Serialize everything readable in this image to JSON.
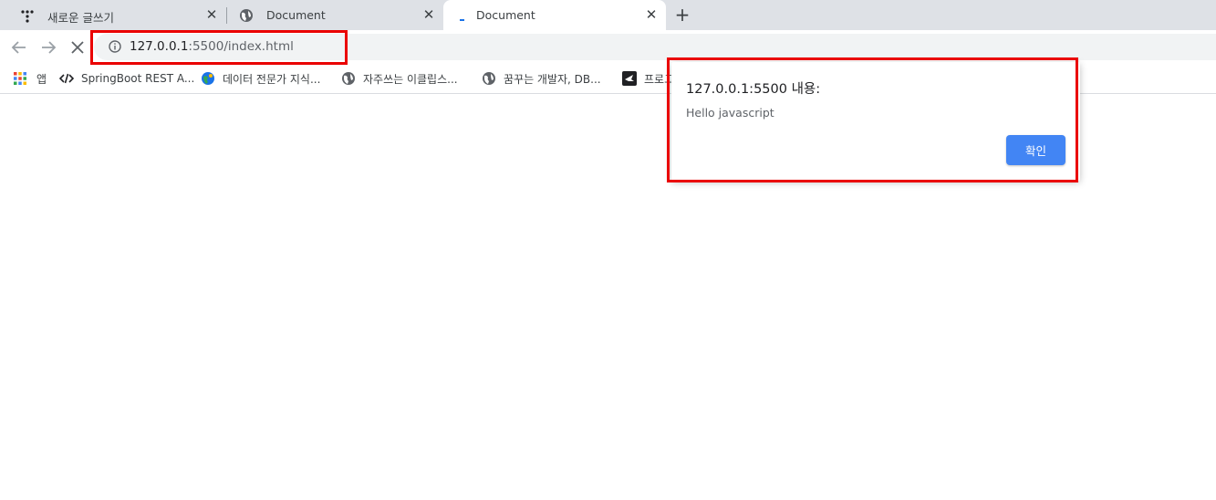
{
  "tabs": [
    {
      "title": "새로운 글쓰기",
      "icon": "tistory-icon",
      "active": false
    },
    {
      "title": "Document",
      "icon": "globe-icon",
      "active": false
    },
    {
      "title": "Document",
      "icon": "loading-icon",
      "active": true
    }
  ],
  "toolbar": {
    "url_host": "127.0.0.1",
    "url_path": ":5500/index.html"
  },
  "bookmarks": [
    {
      "label": "앱",
      "icon": "apps-grid-icon"
    },
    {
      "label": "SpringBoot REST A...",
      "icon": "code-icon"
    },
    {
      "label": "데이터 전문가 지식...",
      "icon": "globe-blue-icon"
    },
    {
      "label": "자주쓰는 이클립스...",
      "icon": "globe-icon"
    },
    {
      "label": "꿈꾸는 개발자, DB...",
      "icon": "globe-icon"
    },
    {
      "label": "프로그",
      "icon": "bird-icon"
    }
  ],
  "dialog": {
    "title": "127.0.0.1:5500 내용:",
    "message": "Hello javascript",
    "ok_label": "확인"
  },
  "colors": {
    "highlight": "#ea0000",
    "accent": "#4285f4",
    "tabstrip": "#dee1e6",
    "omnibox": "#f1f3f4"
  }
}
